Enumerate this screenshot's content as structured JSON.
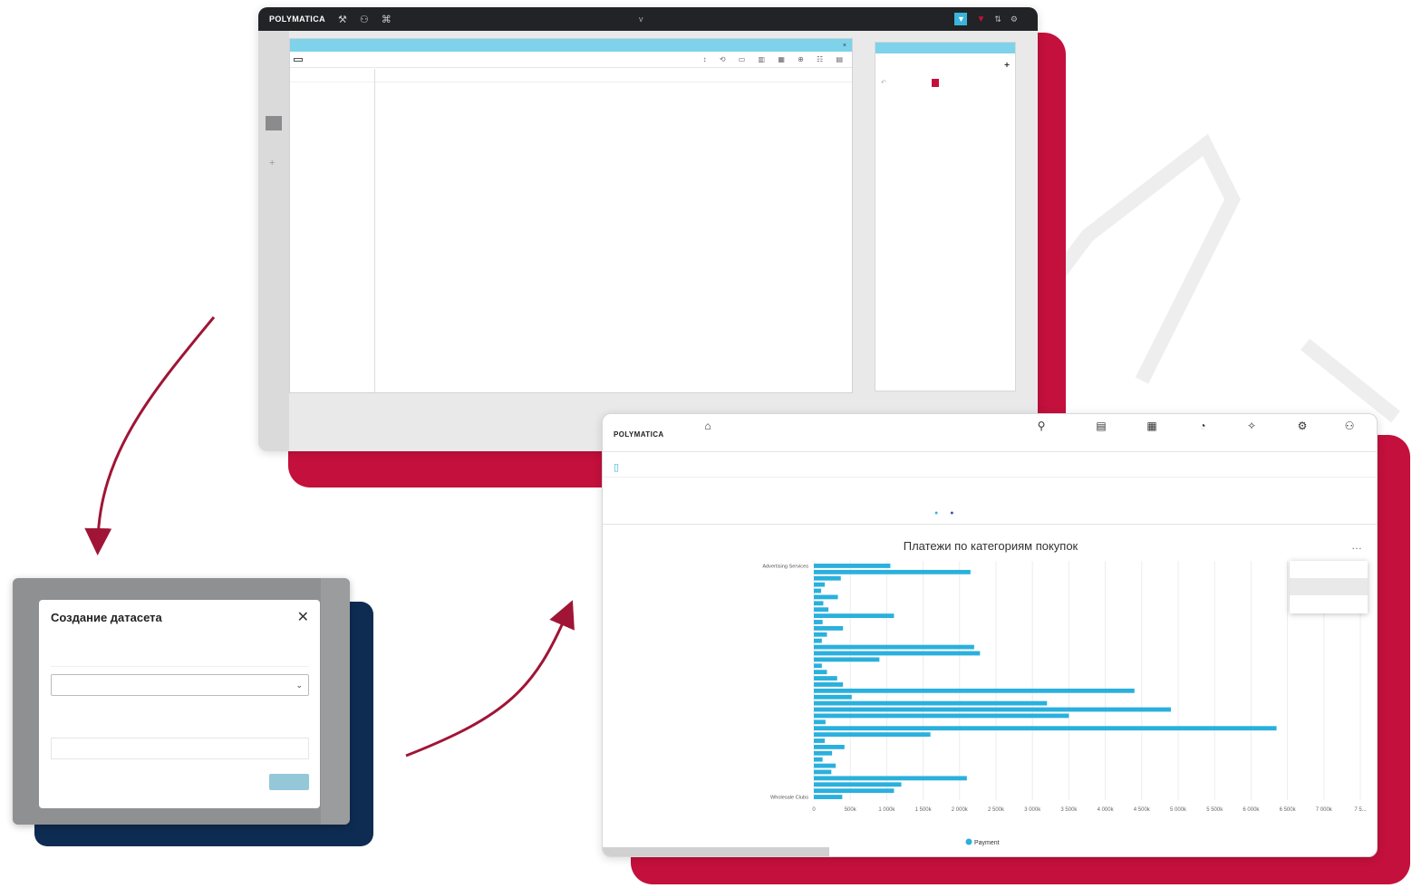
{
  "colors": {
    "accent": "#3ab4da",
    "brand_red": "#c4103c",
    "navy": "#0e2c52",
    "topbar": "#212326"
  },
  "window1": {
    "logo": "POLYMATICA",
    "center_label": "v",
    "user": "",
    "panel_title": "",
    "options_button": "",
    "dimension_rows": [
      {
        "label": "",
        "tag": ""
      }
    ],
    "grid_header": [],
    "grid_rows": [],
    "side": {
      "scenario_heading": "",
      "steps": []
    }
  },
  "window2": {
    "title": "Создание датасета",
    "name_placeholder": "",
    "select_value": "",
    "tab_participants": "",
    "tab_groups": "",
    "search_placeholder": "",
    "submit_label": "",
    "under_text": ""
  },
  "window3": {
    "logo": "POLYMATICA",
    "nav": [
      {
        "glyph": "⌂",
        "label": ""
      },
      {
        "glyph": "⚲",
        "label": ""
      },
      {
        "glyph": "▤",
        "label": ""
      },
      {
        "glyph": "▦",
        "label": ""
      },
      {
        "glyph": "◔",
        "label": ""
      },
      {
        "glyph": "✧",
        "label": ""
      },
      {
        "glyph": "⚙",
        "label": ""
      },
      {
        "glyph": "⚇",
        "label": ""
      }
    ],
    "bar": {
      "title": "",
      "middle": "",
      "right": ""
    },
    "subchart": {
      "group_label": "",
      "legend": [
        "",
        ""
      ]
    },
    "context_menu": [
      "",
      "",
      ""
    ],
    "status_text": ""
  },
  "chart_data": {
    "type": "bar",
    "orientation": "horizontal",
    "title": "Платежи по категориям покупок",
    "xlabel": "",
    "ylabel": "",
    "x_ticks": [
      "0",
      "500k",
      "1 000k",
      "1 500k",
      "2 000k",
      "2 500k",
      "3 000k",
      "3 500k",
      "4 000k",
      "4 500k",
      "5 000k",
      "5 500k",
      "6 000k",
      "6 500k",
      "7 000k",
      "7 5..."
    ],
    "xlim": [
      0,
      7500000
    ],
    "legend": [
      "Payment"
    ],
    "series_color": "#2ab0dd",
    "categories": [
      "Advertising Services",
      "",
      "",
      "",
      "",
      "",
      "",
      "",
      "",
      "",
      "",
      "",
      "",
      "",
      "",
      "",
      "",
      "",
      "",
      "",
      "",
      "",
      "",
      "",
      "",
      "",
      "",
      "",
      "",
      "",
      "",
      "",
      "",
      "",
      "",
      "",
      "",
      "Wholesale Clubs"
    ],
    "values": [
      1050000,
      2150000,
      370000,
      150000,
      100000,
      330000,
      130000,
      200000,
      1100000,
      120000,
      400000,
      180000,
      110000,
      2200000,
      2280000,
      900000,
      110000,
      180000,
      320000,
      400000,
      4400000,
      520000,
      3200000,
      4900000,
      3500000,
      160000,
      6350000,
      1600000,
      150000,
      420000,
      250000,
      120000,
      300000,
      240000,
      2100000,
      1200000,
      1100000,
      390000
    ]
  }
}
